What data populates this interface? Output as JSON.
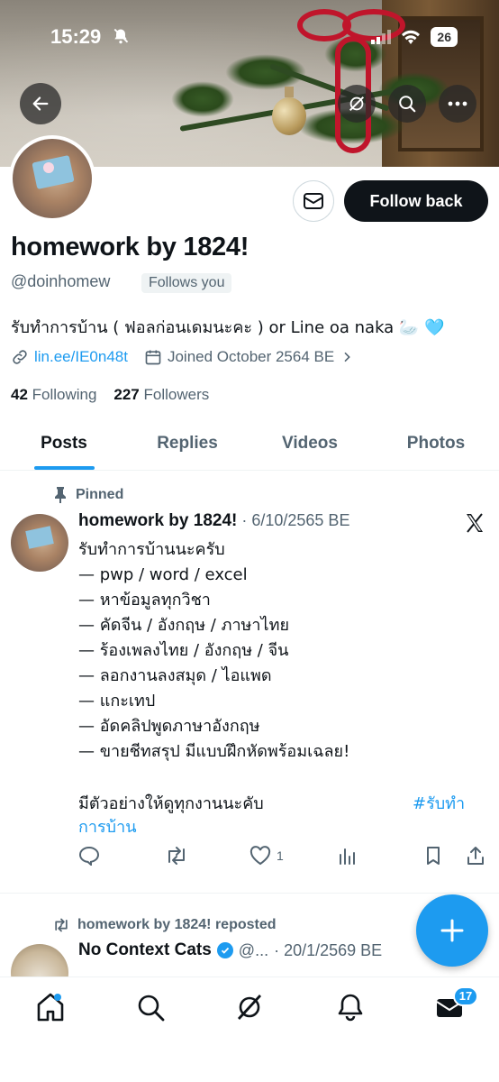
{
  "status_bar": {
    "time": "15:29",
    "battery": "26"
  },
  "profile": {
    "name": "homework by 1824!",
    "handle": "@doinhomew",
    "follows_you": "Follows you",
    "bio": "รับทำการบ้าน ( ฟอลก่อนเดมนะคะ ) or Line oa naka 🦢 🩵",
    "link": "lin.ee/IE0n48t",
    "joined": "Joined October 2564 BE",
    "following_count": "42",
    "following_label": "Following",
    "followers_count": "227",
    "followers_label": "Followers",
    "follow_button": "Follow back"
  },
  "tabs": [
    {
      "label": "Posts",
      "active": true
    },
    {
      "label": "Replies",
      "active": false
    },
    {
      "label": "Videos",
      "active": false
    },
    {
      "label": "Photos",
      "active": false
    }
  ],
  "pinned_post": {
    "pinned_label": "Pinned",
    "author": "homework by 1824!",
    "date": "· 6/10/2565 BE",
    "lines": [
      "รับทำการบ้านนะครับ",
      "— pwp / word / excel",
      "— หาข้อมูลทุกวิชา",
      "— คัดจีน / อังกฤษ / ภาษาไทย",
      "— ร้องเพลงไทย / อังกฤษ / จีน",
      "— ลอกงานลงสมุด / ไอแพด",
      "— แกะเทป",
      "— อัดคลิปพูดภาษาอังกฤษ",
      "— ขายชีทสรุป มีแบบฝึกหัดพร้อมเฉลย!"
    ],
    "last_line": "มีตัวอย่างให้ดูทุกงานนะคับ",
    "hashtag_part1": "#รับทำ",
    "hashtag_part2": "การบ้าน",
    "like_count": "1"
  },
  "repost": {
    "repost_label": "homework by 1824! reposted",
    "author": "No Context Cats",
    "handle": "@...",
    "date": "· 20/1/2569 BE"
  },
  "nav": {
    "messages_badge": "17"
  },
  "icons": [
    "back-arrow-icon",
    "grok-icon",
    "search-icon",
    "more-icon",
    "mail-icon",
    "link-icon",
    "calendar-icon",
    "chevron-right-icon",
    "pin-icon",
    "x-logo-icon",
    "reply-icon",
    "repost-icon",
    "like-icon",
    "views-icon",
    "bookmark-icon",
    "share-icon",
    "verified-icon",
    "plus-icon",
    "home-icon",
    "notifications-icon",
    "messages-icon"
  ],
  "colors": {
    "accent": "#1d9bf0",
    "text": "#0f1419",
    "secondary": "#536471"
  }
}
